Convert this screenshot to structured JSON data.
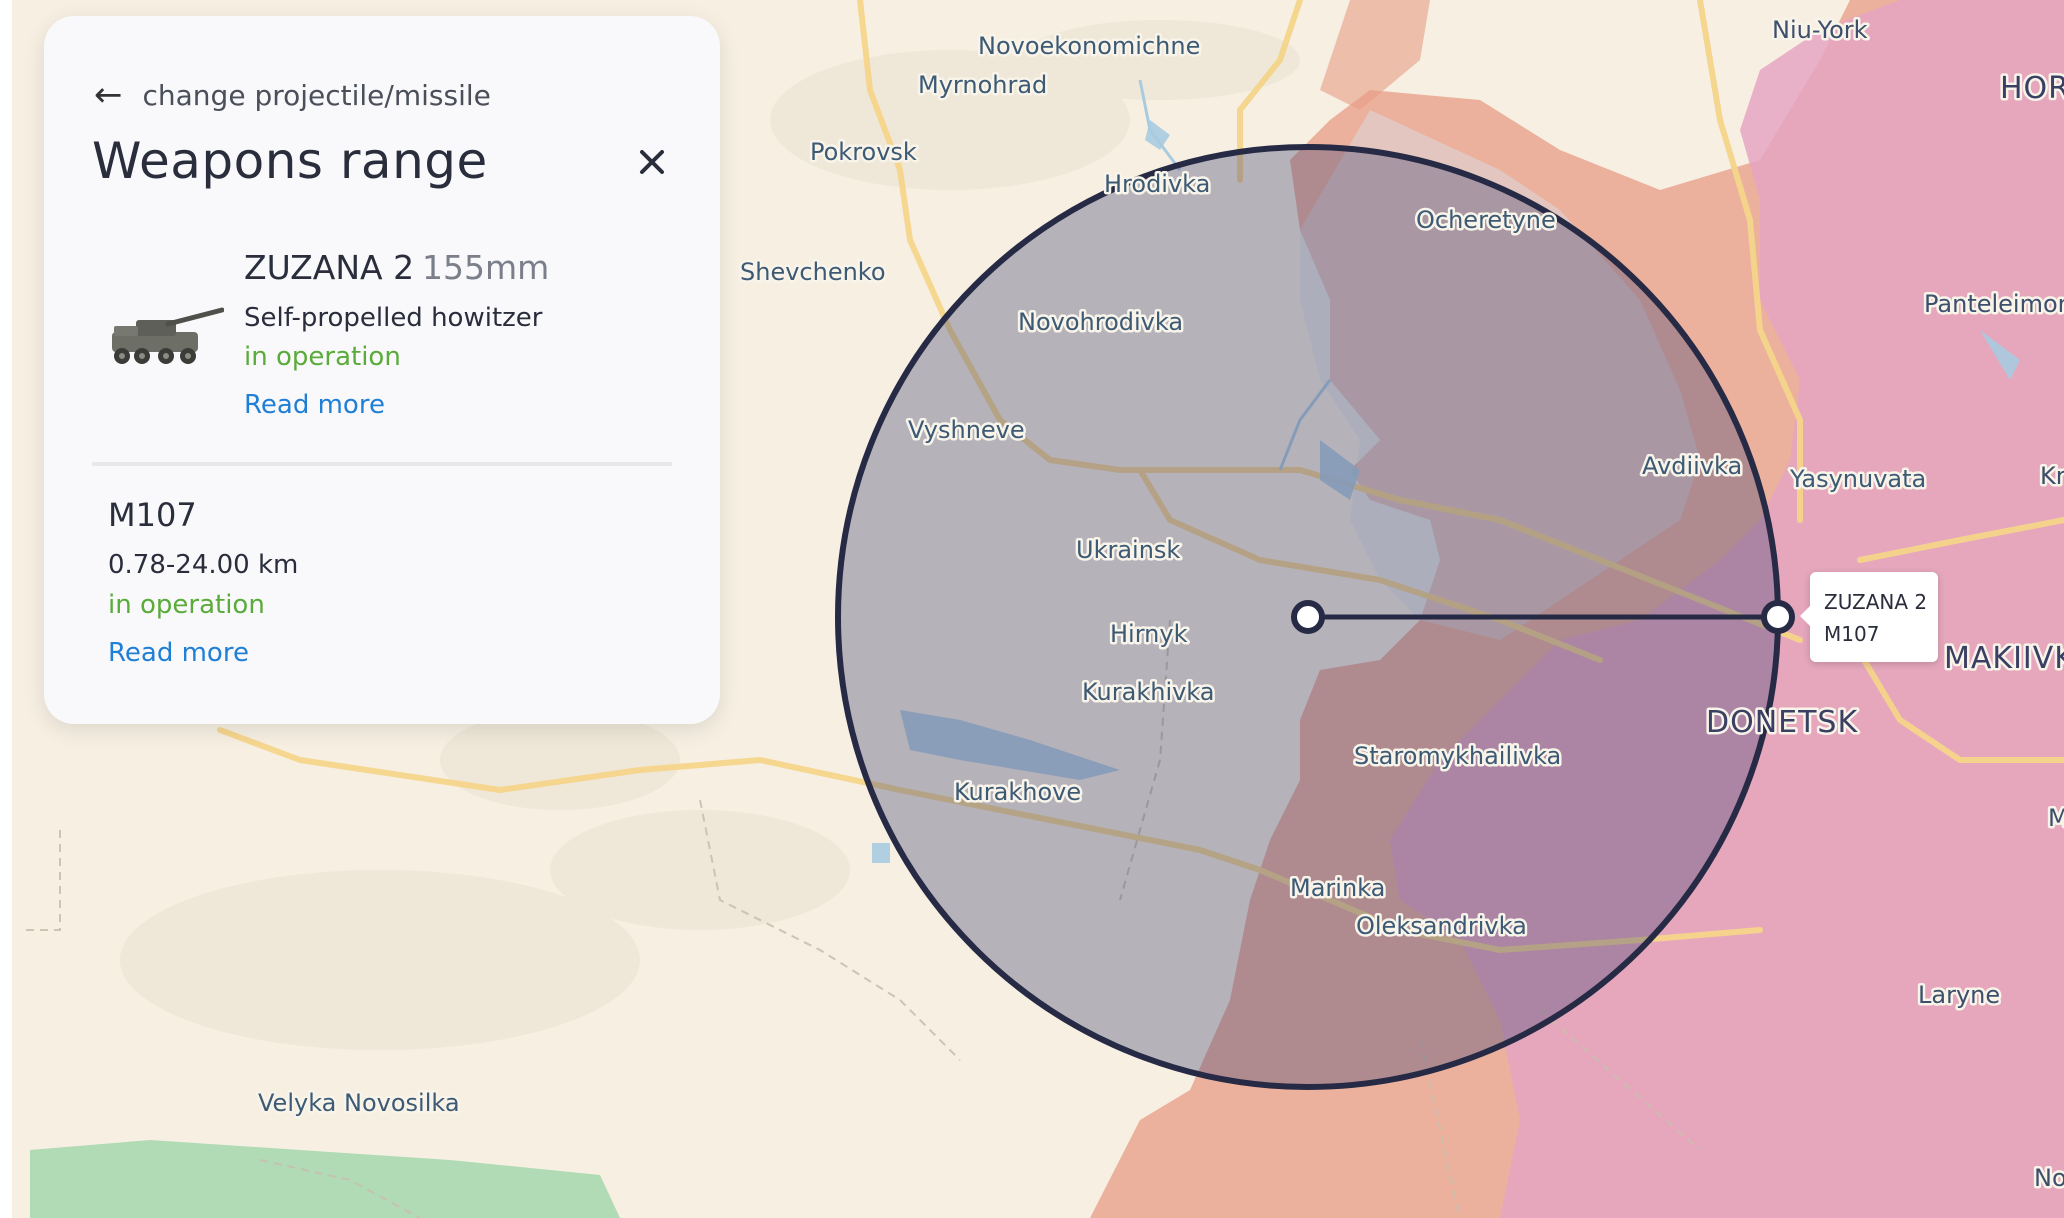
{
  "panel": {
    "back_label": "change projectile/missile",
    "title": "Weapons range",
    "weapon": {
      "name": "ZUZANA 2",
      "caliber": "155mm",
      "type": "Self-propelled howitzer",
      "status": "in operation",
      "read_more": "Read more",
      "image_icon": "howitzer-image"
    },
    "ammo": {
      "name": "M107",
      "range": "0.78-24.00 km",
      "status": "in operation",
      "read_more": "Read more"
    }
  },
  "tooltip": {
    "line1": "ZUZANA 2",
    "line2": "M107"
  },
  "map": {
    "places": [
      "Novoekonomichne",
      "Myrnohrad",
      "Pokrovsk",
      "Shevchenko",
      "Hrodivka",
      "Ocheretyne",
      "Novohrodivka",
      "Vyshneve",
      "Avdiivka",
      "Yasynuvata",
      "Ukrainsk",
      "Hirnyk",
      "Kurakhivka",
      "Staromykhailivka",
      "Kurakhove",
      "Marinka",
      "Oleksandrivka",
      "Velyka Novosilka",
      "Laryne",
      "Panteleimon",
      "Niu-York",
      "HORL",
      "MAKIIVKA",
      "DONETSK",
      "Kr",
      "M",
      "No"
    ]
  },
  "colors": {
    "map_bg": "#f6efe2",
    "occupied_pink": "#e8a5b8",
    "front_red": "#e79a84",
    "range_circle_fill": "#4a4d7a",
    "range_circle_stroke": "#262a45",
    "status_green": "#5aab3a",
    "link_blue": "#1f7fd6"
  }
}
